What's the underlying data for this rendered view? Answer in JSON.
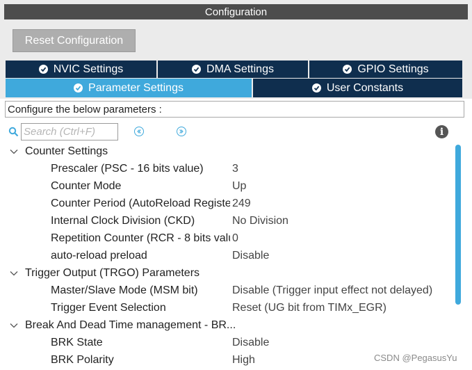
{
  "window": {
    "title": "Configuration"
  },
  "toolbar": {
    "reset_label": "Reset Configuration"
  },
  "tabs": {
    "row1": [
      {
        "label": "NVIC Settings"
      },
      {
        "label": "DMA Settings"
      },
      {
        "label": "GPIO Settings"
      }
    ],
    "row2": [
      {
        "label": "Parameter Settings",
        "active": true
      },
      {
        "label": "User Constants"
      }
    ]
  },
  "description": "Configure the below parameters :",
  "search": {
    "placeholder": "Search (Ctrl+F)"
  },
  "groups": [
    {
      "label": "Counter Settings",
      "params": [
        {
          "name": "Prescaler (PSC - 16 bits value)",
          "value": "3"
        },
        {
          "name": "Counter Mode",
          "value": "Up"
        },
        {
          "name": "Counter Period (AutoReload Registe.",
          "value": "249"
        },
        {
          "name": "Internal Clock Division (CKD)",
          "value": "No Division"
        },
        {
          "name": "Repetition Counter (RCR - 8 bits valu.",
          "value": "0"
        },
        {
          "name": "auto-reload preload",
          "value": "Disable"
        }
      ]
    },
    {
      "label": "Trigger Output (TRGO) Parameters",
      "params": [
        {
          "name": "Master/Slave Mode (MSM bit)",
          "value": "Disable (Trigger input effect not delayed)"
        },
        {
          "name": "Trigger Event Selection",
          "value": "Reset (UG bit from TIMx_EGR)"
        }
      ]
    },
    {
      "label": "Break And Dead Time management - BR...",
      "params": [
        {
          "name": "BRK State",
          "value": "Disable"
        },
        {
          "name": "BRK Polarity",
          "value": "High"
        }
      ]
    }
  ],
  "watermark": "CSDN @PegasusYu",
  "colors": {
    "tab_dark": "#0f2e4e",
    "tab_active": "#3fa9dc",
    "title_bg": "#4d4d4d"
  }
}
